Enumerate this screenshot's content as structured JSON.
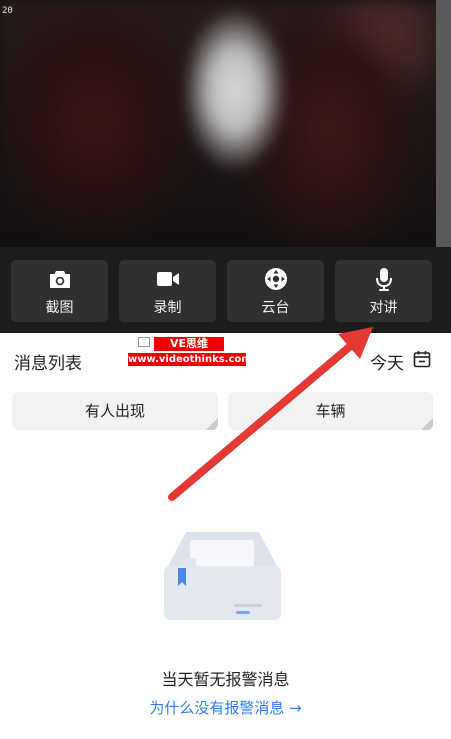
{
  "video": {
    "timestamp": "20"
  },
  "controls": [
    {
      "label": "截图",
      "icon": "camera-icon"
    },
    {
      "label": "录制",
      "icon": "video-camera-icon"
    },
    {
      "label": "云台",
      "icon": "ptz-control-icon"
    },
    {
      "label": "对讲",
      "icon": "microphone-icon"
    }
  ],
  "messages": {
    "title": "消息列表",
    "date_label": "今天",
    "filters": [
      {
        "label": "有人出现"
      },
      {
        "label": "车辆"
      }
    ],
    "empty_title": "当天暂无报警消息",
    "empty_link": "为什么没有报警消息 →"
  },
  "watermark": {
    "line1": "VE思维",
    "line2": "www.videothinks.com"
  },
  "colors": {
    "accent": "#2f7cf6",
    "annotation_arrow": "#e53935",
    "control_bar": "#1c1c1c",
    "control_button": "#2f3032",
    "chip_bg": "#f1f2f4"
  }
}
